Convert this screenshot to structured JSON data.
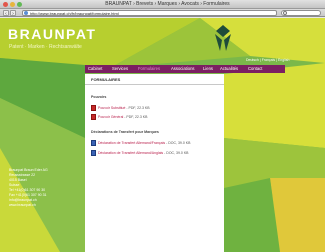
{
  "window": {
    "title": "BRAUNPAT › Brevets › Marques › Avocats › Formulaires",
    "url": "http://www.braunpat.ch/fr/braunpat/formulaire.html"
  },
  "site": {
    "brand": "BRAUNPAT",
    "tagline": "Patent · Marken · Rechtsanwälte",
    "languages": "Deutsch | Français | English",
    "menu": [
      {
        "label": "Cabinet",
        "active": false
      },
      {
        "label": "Services",
        "active": false
      },
      {
        "label": "Formulaires",
        "active": true
      },
      {
        "label": "Associations",
        "active": false
      },
      {
        "label": "Liens",
        "active": false
      },
      {
        "label": "Actualités",
        "active": false
      },
      {
        "label": "Contact",
        "active": false
      }
    ],
    "content": {
      "title": "FORMULAIRES",
      "sections": [
        {
          "heading": "Pouvoirs",
          "items": [
            {
              "icon": "pdf-icon",
              "link": "Pouvoir Substitué",
              "info": "- PDF, 22.3 KB"
            },
            {
              "icon": "pdf-icon",
              "link": "Pouvoir Général",
              "info": "- PDF, 22.3 KB"
            }
          ]
        },
        {
          "heading": "Déclarations de Transfert pour Marques",
          "items": [
            {
              "icon": "doc-icon",
              "link": "Déclaration de Transfert Allemand/Français",
              "info": "- DOC, 39.0 KB"
            },
            {
              "icon": "doc-icon",
              "link": "Déclaration de Transfert Allemand/Anglais",
              "info": "- DOC, 39.0 KB"
            }
          ]
        }
      ]
    },
    "address": [
      "Braunpat Braun Eder AG",
      "Reussstrasse 22",
      "4015 Basel",
      "Suisse",
      "Tel +41(0)61 307 90 30",
      "Fax +41(0)61 307 90 31",
      "info@braunpat.ch",
      "www.braunpat.ch"
    ],
    "colors": {
      "menu_bar": "#7b1f62",
      "active_menu": "#e08bd1",
      "link": "#b81d4a",
      "green": "#7bb84a",
      "lime": "#b7cf2f",
      "yellow": "#d6df3c"
    }
  }
}
